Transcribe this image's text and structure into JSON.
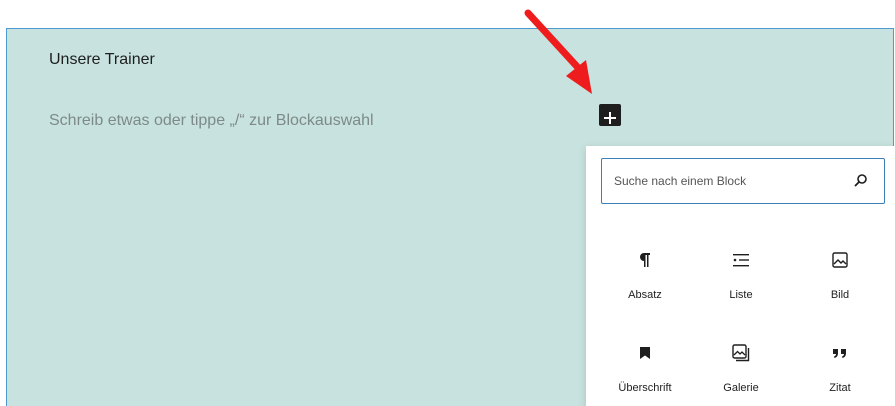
{
  "group": {
    "heading": "Unsere Trainer",
    "placeholder": "Schreib etwas oder tippe „/“ zur Blockauswahl"
  },
  "inserter_toggle": {
    "icon": "plus-icon"
  },
  "search": {
    "placeholder": "Suche nach einem Block",
    "value": "",
    "icon": "search-icon"
  },
  "blocks": [
    {
      "label": "Absatz",
      "icon": "paragraph-icon"
    },
    {
      "label": "Liste",
      "icon": "list-icon"
    },
    {
      "label": "Bild",
      "icon": "image-icon"
    },
    {
      "label": "Überschrift",
      "icon": "bookmark-icon"
    },
    {
      "label": "Galerie",
      "icon": "gallery-icon"
    },
    {
      "label": "Zitat",
      "icon": "quote-icon"
    }
  ],
  "colors": {
    "group_background": "#c8e3df",
    "selection_border": "#4e9ad0",
    "search_focus": "#3c7fb8",
    "annotation_arrow": "#ee1c1c"
  }
}
